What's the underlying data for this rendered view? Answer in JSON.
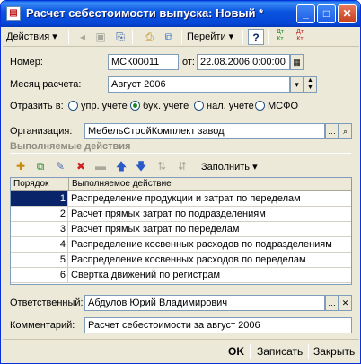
{
  "window": {
    "title": "Расчет себестоимости выпуска: Новый *",
    "icon_glyph": "▤"
  },
  "toolbar": {
    "actions_label": "Действия",
    "goto_label": "Перейти",
    "help_glyph": "?",
    "dt1": "Дт\nКт",
    "dt2": "Дт\nКт"
  },
  "form": {
    "number_label": "Номер:",
    "number_value": "МСК00011",
    "date_label": "от:",
    "date_value": "22.08.2006  0:00:00",
    "month_label": "Месяц расчета:",
    "month_value": "Август 2006",
    "reflect_label": "Отразить в:",
    "reflect_options": [
      {
        "label": "упр. учете",
        "checked": false
      },
      {
        "label": "бух. учете",
        "checked": true
      },
      {
        "label": "нал. учете",
        "checked": false
      },
      {
        "label": "МСФО",
        "checked": false
      }
    ],
    "org_label": "Организация:",
    "org_value": "МебельСтройКомплект завод",
    "actions_section_title": "Выполняемые действия",
    "fill_label": "Заполнить",
    "responsible_label": "Ответственный:",
    "responsible_value": "Абдулов Юрий Владимирович",
    "comment_label": "Комментарий:",
    "comment_value": "Расчет себестоимости за август 2006"
  },
  "table": {
    "headers": [
      "Порядок",
      "Выполняемое действие"
    ],
    "rows": [
      {
        "order": "1",
        "action": "Распределение продукции и затрат по переделам",
        "selected": true
      },
      {
        "order": "2",
        "action": "Расчет прямых затрат по подразделениям",
        "selected": false
      },
      {
        "order": "3",
        "action": "Расчет прямых затрат по переделам",
        "selected": false
      },
      {
        "order": "4",
        "action": "Распределение косвенных расходов по подразделениям",
        "selected": false
      },
      {
        "order": "5",
        "action": "Распределение косвенных расходов по переделам",
        "selected": false
      },
      {
        "order": "6",
        "action": "Свертка движений по регистрам",
        "selected": false
      }
    ]
  },
  "footer": {
    "ok_label": "OK",
    "save_label": "Записать",
    "close_label": "Закрыть"
  },
  "colors": {
    "title_blue": "#0546d6",
    "selection": "#0a246a",
    "face": "#ece9d8"
  }
}
